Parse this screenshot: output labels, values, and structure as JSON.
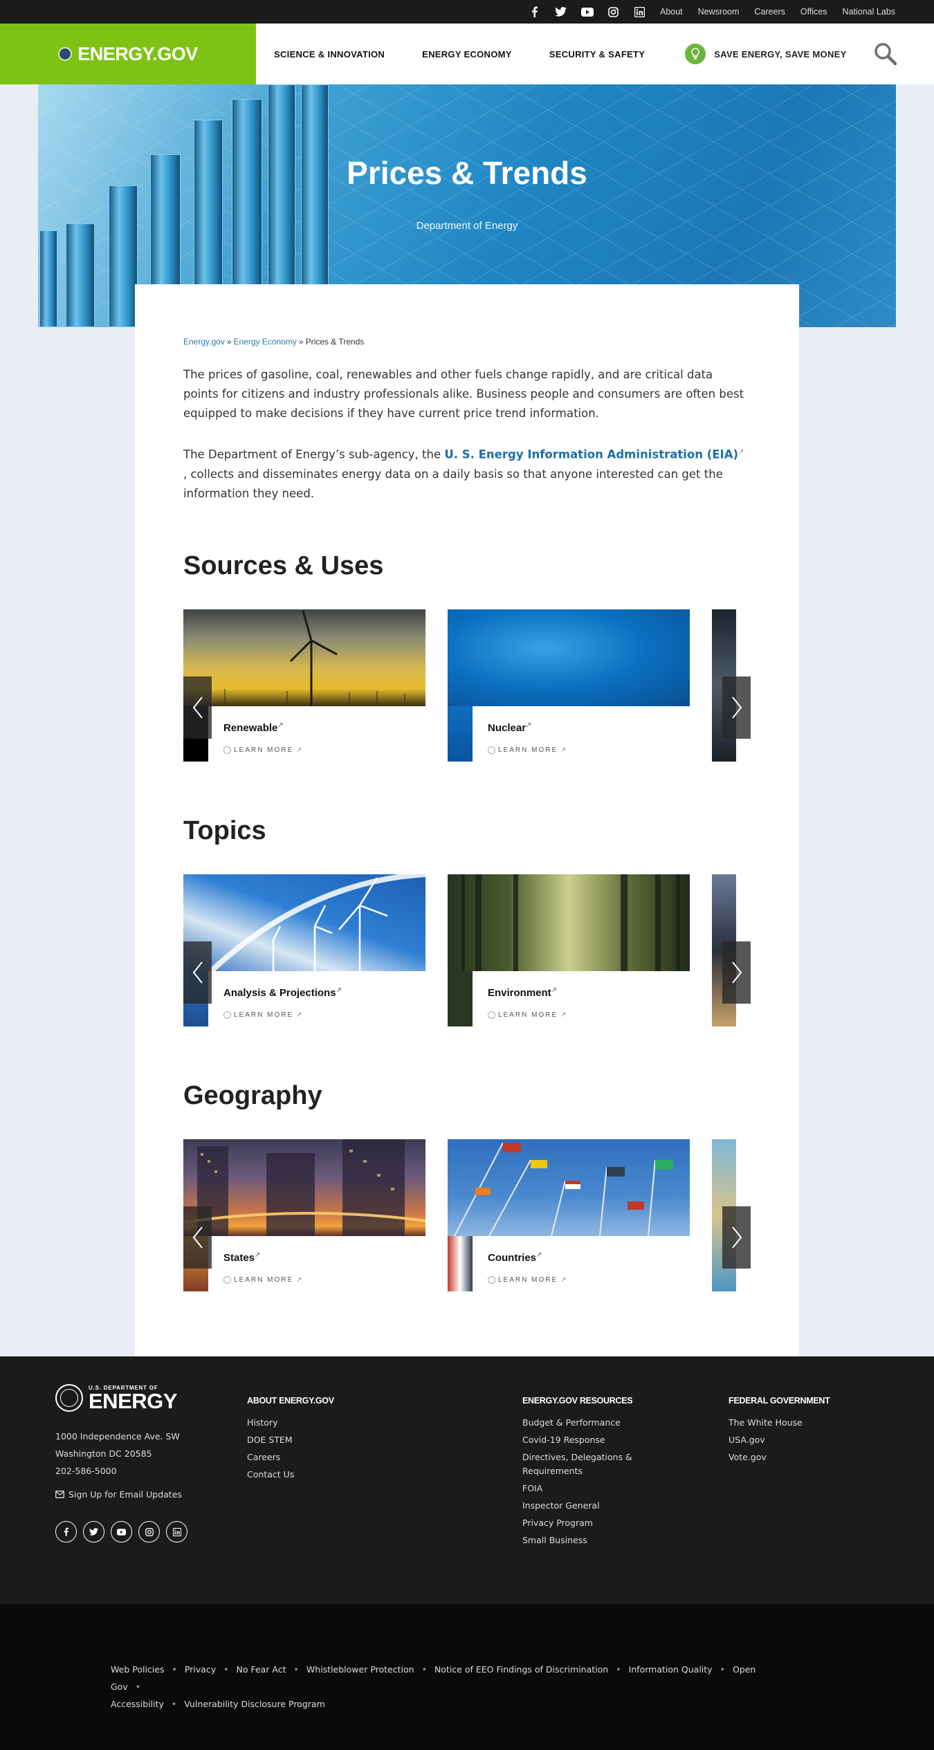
{
  "topbar": {
    "social_icons": [
      "facebook-icon",
      "twitter-icon",
      "youtube-icon",
      "instagram-icon",
      "linkedin-icon"
    ],
    "links": [
      "About",
      "Newsroom",
      "Careers",
      "Offices",
      "National Labs"
    ]
  },
  "header": {
    "logo_text": "ENERGY.GOV",
    "nav": [
      "SCIENCE & INNOVATION",
      "ENERGY ECONOMY",
      "SECURITY & SAFETY"
    ],
    "save_energy": "SAVE ENERGY, SAVE MONEY",
    "brand_color": "#7ec313"
  },
  "hero": {
    "title": "Prices & Trends",
    "subtitle": "Department of Energy"
  },
  "breadcrumb": {
    "items": [
      "Energy.gov",
      "Energy Economy",
      "Prices & Trends"
    ],
    "separator": "»"
  },
  "intro": {
    "p1": "The prices of gasoline, coal, renewables and other fuels change rapidly, and are critical data points for citizens and industry professionals alike.  Business people and consumers are often best equipped to make decisions if they have current price trend information.",
    "p2_before": "The Department of Energy’s sub-agency, the ",
    "p2_link": "U. S. Energy Information Administration (EIA)",
    "p2_after": " , collects and disseminates energy data on a daily basis so that anyone interested can get the information they need."
  },
  "learn_more": "LEARN MORE",
  "sections": [
    {
      "title": "Sources & Uses",
      "cards": [
        "Renewable",
        "Nuclear"
      ]
    },
    {
      "title": "Topics",
      "cards": [
        "Analysis & Projections",
        "Environment"
      ]
    },
    {
      "title": "Geography",
      "cards": [
        "States",
        "Countries"
      ]
    }
  ],
  "footer": {
    "logo_small": "U.S. DEPARTMENT OF",
    "logo_big": "ENERGY",
    "address": [
      "1000 Independence Ave. SW",
      "Washington DC 20585",
      "202-586-5000"
    ],
    "email_signup": "Sign Up for Email Updates",
    "columns": [
      {
        "title": "ABOUT ENERGY.GOV",
        "items": [
          "History",
          "DOE STEM",
          "Careers",
          "Contact Us"
        ]
      },
      {
        "title": "ENERGY.GOV RESOURCES",
        "items": [
          "Budget & Performance",
          "Covid-19 Response",
          "Directives, Delegations & Requirements",
          "FOIA",
          "Inspector General",
          "Privacy Program",
          "Small Business"
        ]
      },
      {
        "title": "FEDERAL GOVERNMENT",
        "items": [
          "The White House",
          "USA.gov",
          "Vote.gov"
        ]
      }
    ]
  },
  "legal": {
    "links": [
      "Web Policies",
      "Privacy",
      "No Fear Act",
      "Whistleblower Protection",
      "Notice of EEO Findings of Discrimination",
      "Information Quality",
      "Open Gov",
      "Accessibility",
      "Vulnerability Disclosure Program"
    ]
  }
}
